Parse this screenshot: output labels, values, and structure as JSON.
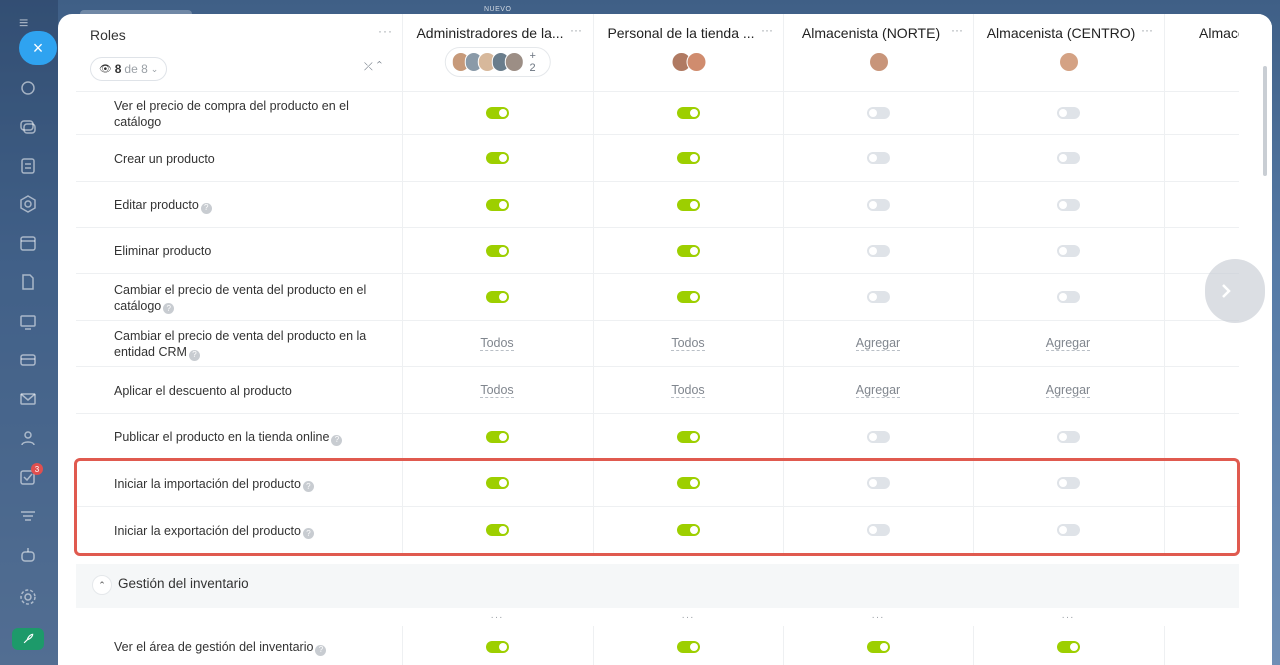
{
  "banner": {
    "nuevo": "NUEVO"
  },
  "rail": {
    "close_label": "×",
    "badge_count": "3",
    "icons": [
      "hamburger-icon",
      "chat-icon",
      "messages-icon",
      "feed-icon",
      "hexagon-icon",
      "calendar-icon",
      "document-icon",
      "sites-icon",
      "card-icon",
      "mail-icon",
      "users-icon",
      "tasks-icon",
      "filter-icon",
      "robot-icon",
      "settings-icon",
      "rocket-icon"
    ]
  },
  "header": {
    "roles_title": "Roles",
    "filter_count": "8",
    "filter_of": "de 8",
    "columns": [
      {
        "title": "Administradores de la...",
        "plus": "+ 2"
      },
      {
        "title": "Personal de la tienda ...",
        "plus": ""
      },
      {
        "title": "Almacenista (NORTE)",
        "plus": ""
      },
      {
        "title": "Almacenista (CENTRO)",
        "plus": ""
      },
      {
        "title": "Almacenista (SUR)",
        "plus": ""
      }
    ]
  },
  "rows": [
    {
      "label": "Ver el precio de compra del producto en el catálogo",
      "help": false,
      "values": [
        "on",
        "on",
        "off",
        "off"
      ]
    },
    {
      "label": "Crear un producto",
      "help": false,
      "values": [
        "on",
        "on",
        "off",
        "off"
      ]
    },
    {
      "label": "Editar producto",
      "help": true,
      "values": [
        "on",
        "on",
        "off",
        "off"
      ]
    },
    {
      "label": "Eliminar producto",
      "help": false,
      "values": [
        "on",
        "on",
        "off",
        "off"
      ]
    },
    {
      "label": "Cambiar el precio de venta del producto en el catálogo",
      "help": true,
      "values": [
        "on",
        "on",
        "off",
        "off"
      ]
    },
    {
      "label": "Cambiar el precio de venta del producto en la entidad CRM",
      "help": true,
      "values": [
        "Todos",
        "Todos",
        "Agregar",
        "Agregar"
      ]
    },
    {
      "label": "Aplicar el descuento al producto",
      "help": false,
      "values": [
        "Todos",
        "Todos",
        "Agregar",
        "Agregar"
      ]
    },
    {
      "label": "Publicar el producto en la tienda online",
      "help": true,
      "values": [
        "on",
        "on",
        "off",
        "off"
      ]
    },
    {
      "label": "Iniciar la importación del producto",
      "help": true,
      "values": [
        "on",
        "on",
        "off",
        "off"
      ]
    },
    {
      "label": "Iniciar la exportación del producto",
      "help": true,
      "values": [
        "on",
        "on",
        "off",
        "off"
      ]
    }
  ],
  "section": {
    "title": "Gestión del inventario"
  },
  "inventory_rows": [
    {
      "label": "Ver el área de gestión del inventario",
      "help": true,
      "values": [
        "on",
        "on",
        "on",
        "on"
      ]
    }
  ],
  "colors": {
    "toggle_on": "#9dcf00",
    "toggle_off": "#dfe3e8",
    "highlight": "#e05a4f",
    "accent": "#2fa3f0"
  }
}
